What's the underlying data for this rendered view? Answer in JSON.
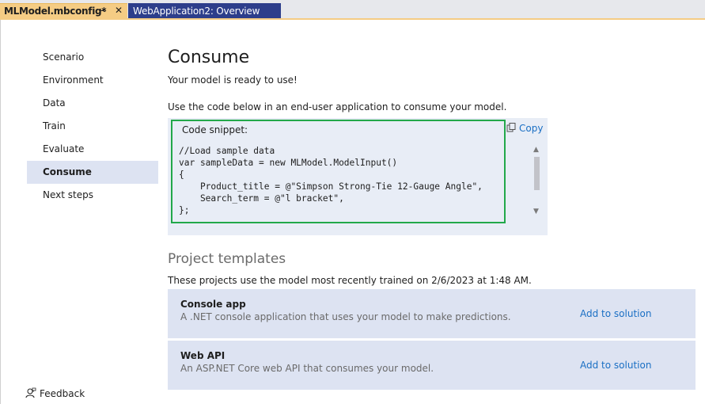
{
  "tabs": [
    {
      "label": "MLModel.mbconfig*",
      "active": true
    },
    {
      "label": "WebApplication2: Overview",
      "active": false
    }
  ],
  "tab_icons": {
    "pin": "pin-icon",
    "close": "close-icon"
  },
  "nav": {
    "items": [
      {
        "label": "Scenario"
      },
      {
        "label": "Environment"
      },
      {
        "label": "Data"
      },
      {
        "label": "Train"
      },
      {
        "label": "Evaluate"
      },
      {
        "label": "Consume",
        "active": true
      },
      {
        "label": "Next steps"
      }
    ],
    "feedback_label": "Feedback"
  },
  "consume": {
    "title": "Consume",
    "ready_text": "Your model is ready to use!",
    "use_text": "Use the code below in an end-user application to consume your model.",
    "snippet_label": "Code snippet:",
    "copy_label": "Copy",
    "code": "//Load sample data\nvar sampleData = new MLModel.ModelInput()\n{\n    Product_title = @\"Simpson Strong-Tie 12-Gauge Angle\",\n    Search_term = @\"l bracket\",\n};"
  },
  "project_templates": {
    "title": "Project templates",
    "description": "These projects use the model most recently trained on 2/6/2023 at 1:48 AM.",
    "cards": [
      {
        "title": "Console app",
        "description": "A .NET console application that uses your model to make predictions.",
        "action": "Add to solution"
      },
      {
        "title": "Web API",
        "description": "An ASP.NET Core web API that consumes your model.",
        "action": "Add to solution"
      }
    ]
  },
  "colors": {
    "active_tab": "#f5cc84",
    "inactive_tab": "#2d3e8b",
    "snippet_border": "#22a84a",
    "link": "#1a6fc4",
    "nav_active": "#dde3f2"
  }
}
